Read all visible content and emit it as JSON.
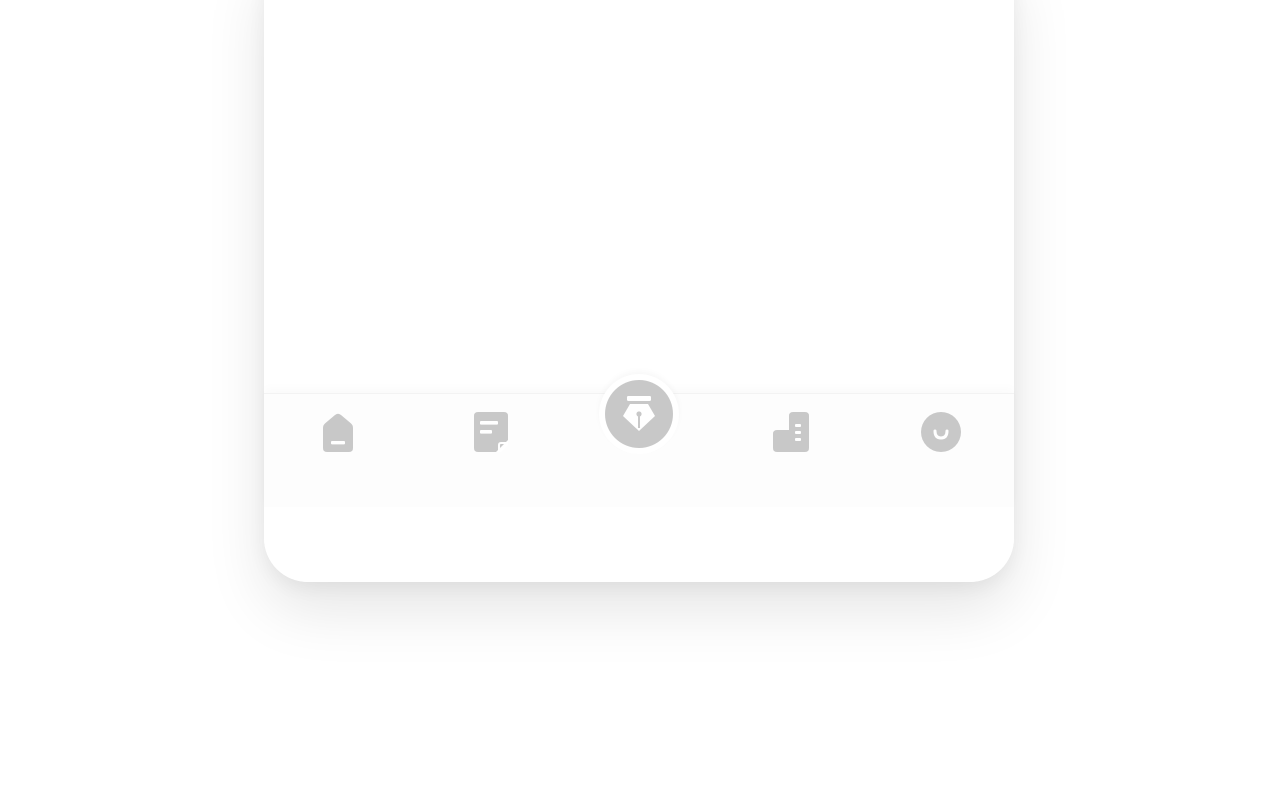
{
  "colors": {
    "icon": "#c8c8c8",
    "page_background": "#ffffff",
    "tabbar_background": "#fdfdfd"
  },
  "tabbar": {
    "tabs": [
      {
        "icon": "home-icon"
      },
      {
        "icon": "note-icon"
      },
      {
        "icon": "fountain-pen-icon",
        "center": true
      },
      {
        "icon": "buildings-icon"
      },
      {
        "icon": "smiley-profile-icon"
      }
    ]
  }
}
